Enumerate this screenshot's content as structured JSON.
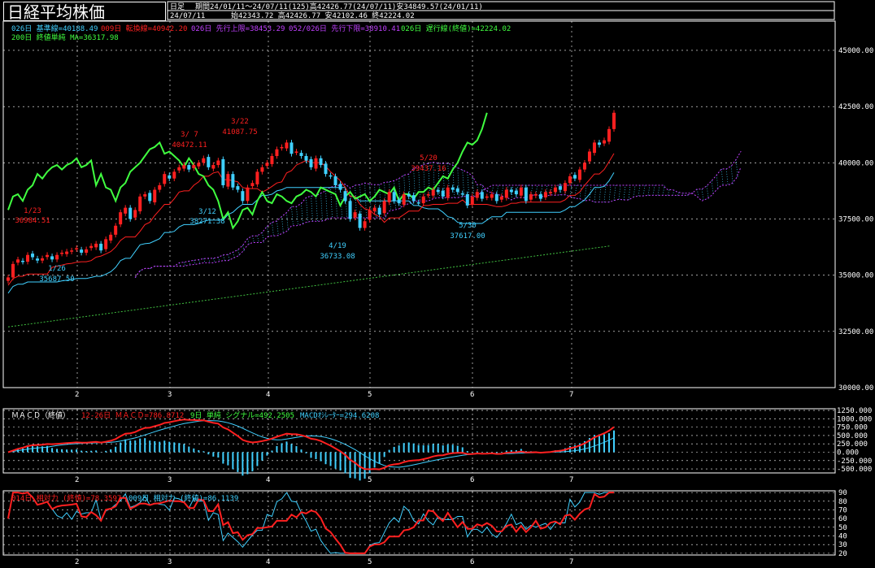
{
  "header": {
    "title": "日経平均株価",
    "period_label": "日足",
    "period_text": "期間24/01/11～24/07/11(125)高42426.77(24/07/11)安34849.57(24/01/11)",
    "date": "24/07/11",
    "ohlc_text": "始42343.72 高42426.77 安42102.46 終42224.02"
  },
  "legend": {
    "kijun": "026日 基準線=40188.49",
    "tenkan": "009日 転換線=40942.20",
    "senkou_a": "026日 先行上限=38453.29",
    "senkou_b": "052/026日 先行下限=38910.41",
    "chikou": "026日 遅行線(終値)=42224.02",
    "ma200": "200日 終値単純 MA=36317.98",
    "macd_label": "ＭＡＣＤ（終値）",
    "macd_line": "12-26日 ＭＡＣＤ=786.8712",
    "signal": "9日 単純 シグナル=492.2505",
    "oscillator": "MACDｵｼﾚｰﾀｰ=294.6208",
    "rsi14": "014日 相対力 (終値)=78.3597",
    "rsi9": "009日 相対力 (終値)=86.1139"
  },
  "colors": {
    "up": "#ff2020",
    "down": "#40d0ff",
    "kijun": "#40d0ff",
    "tenkan": "#ff2020",
    "senkou_a": "#c040ff",
    "senkou_b": "#c040ff",
    "cloud": "#40d0ff",
    "chikou": "#40ff40",
    "ma200": "#40c040",
    "macd": "#ff2020",
    "signal": "#40d0ff",
    "rsi14": "#ff2020",
    "rsi9": "#40d0ff",
    "grid": "#ffffff",
    "frame": "#ffffff",
    "text": "#ffffff"
  },
  "chart_data": [
    {
      "type": "candlestick",
      "panel": "price",
      "x_tick_labels": [
        "2",
        "3",
        "4",
        "5",
        "6",
        "7"
      ],
      "y_ticks": [
        30000,
        32500,
        35000,
        37500,
        40000,
        42500,
        45000
      ],
      "y_tick_labels": [
        "30000.00",
        "32500.00",
        "35000.00",
        "37500.00",
        "40000.00",
        "42500.00",
        "45000.00"
      ],
      "ylim": [
        30000,
        46300
      ],
      "grid": true,
      "start_close": 34900,
      "closes_relative_note": "",
      "closes": [
        34900,
        35500,
        35700,
        35600,
        35900,
        35800,
        35650,
        35750,
        35900,
        35700,
        35900,
        36000,
        36050,
        36100,
        36200,
        36000,
        36150,
        36300,
        36400,
        36100,
        36600,
        36800,
        37200,
        37800,
        38000,
        37500,
        37900,
        38500,
        38600,
        38300,
        38800,
        39000,
        39500,
        39300,
        39600,
        39800,
        39900,
        39700,
        39900,
        40000,
        40200,
        39800,
        39900,
        40100,
        39000,
        39500,
        38900,
        38800,
        38300,
        38900,
        39100,
        39600,
        39800,
        40000,
        40300,
        40600,
        40700,
        40900,
        40400,
        40500,
        40300,
        40100,
        39800,
        40200,
        39900,
        39500,
        39400,
        39000,
        38800,
        38300,
        37500,
        37800,
        37100,
        37400,
        37900,
        38000,
        37700,
        38300,
        38700,
        38300,
        38200,
        38600,
        38500,
        38300,
        38200,
        38500,
        38600,
        38800,
        38700,
        38500,
        38900,
        38800,
        38700,
        38600,
        38100,
        38500,
        38700,
        38400,
        38500,
        38600,
        38300,
        38500,
        38800,
        38700,
        38600,
        38900,
        38300,
        38600,
        38600,
        38400,
        38700,
        38700,
        38900,
        38800,
        39100,
        39400,
        39300,
        39700,
        40000,
        40500,
        40900,
        40800,
        41000,
        41500,
        42224
      ],
      "annotations": [
        {
          "text": "1/23",
          "value": "36984.51",
          "color": "#ff2020"
        },
        {
          "text": "1/26",
          "value": "35687.50",
          "color": "#40d0ff"
        },
        {
          "text": "3/ 7",
          "value": "40472.11",
          "color": "#ff2020"
        },
        {
          "text": "3/22",
          "value": "41087.75",
          "color": "#ff2020"
        },
        {
          "text": "3/12",
          "value": "38271.38",
          "color": "#40d0ff"
        },
        {
          "text": "4/19",
          "value": "36733.08",
          "color": "#40d0ff"
        },
        {
          "text": "5/20",
          "value": "39437.16",
          "color": "#ff2020"
        },
        {
          "text": "5/30",
          "value": "37617.00",
          "color": "#40d0ff"
        }
      ],
      "series": [
        {
          "name": "026日 基準線",
          "key": "kijun"
        },
        {
          "name": "009日 転換線",
          "key": "tenkan"
        },
        {
          "name": "026日 先行上限",
          "key": "senkou_a"
        },
        {
          "name": "052/026日 先行下限",
          "key": "senkou_b"
        },
        {
          "name": "026日 遅行線(終値)",
          "key": "chikou"
        },
        {
          "name": "200日 終値単純 MA",
          "key": "ma200",
          "start": 32700,
          "end": 36300
        }
      ]
    },
    {
      "type": "line",
      "panel": "macd",
      "y_ticks": [
        -500,
        -250,
        0,
        250,
        500,
        750,
        1000,
        1250
      ],
      "y_tick_labels": [
        "-500.000",
        "-250.000",
        "0.000",
        "250.000",
        "500.000",
        "750.000",
        "1000.000",
        "1250.000"
      ],
      "ylim": [
        -620,
        1300
      ],
      "grid": true,
      "series": [
        {
          "name": "12-26日 ＭＡＣＤ",
          "key": "macd"
        },
        {
          "name": "9日 単純 シグナル",
          "key": "signal"
        },
        {
          "name": "MACDｵｼﾚｰﾀｰ",
          "key": "oscillator",
          "kind": "bar"
        }
      ]
    },
    {
      "type": "line",
      "panel": "rsi",
      "y_ticks": [
        20,
        30,
        40,
        50,
        60,
        70,
        80,
        90
      ],
      "y_tick_labels": [
        "20",
        "30",
        "40",
        "50",
        "60",
        "70",
        "80",
        "90"
      ],
      "ylim": [
        18,
        92
      ],
      "grid": true,
      "series": [
        {
          "name": "014日 相対力 (終値)",
          "key": "rsi14"
        },
        {
          "name": "009日 相対力 (終値)",
          "key": "rsi9"
        }
      ]
    }
  ]
}
